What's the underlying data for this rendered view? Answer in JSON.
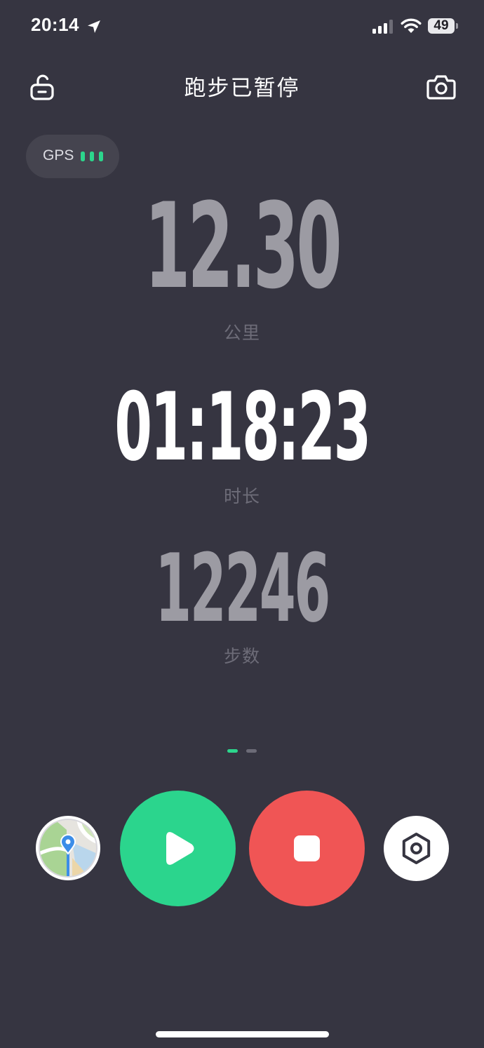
{
  "status_bar": {
    "time": "20:14",
    "battery": "49",
    "location_icon": "location-arrow-icon",
    "signal_icon": "cellular-signal-icon",
    "wifi_icon": "wifi-icon"
  },
  "header": {
    "title": "跑步已暂停",
    "lock_icon": "unlock-icon",
    "camera_icon": "camera-icon"
  },
  "gps": {
    "label": "GPS",
    "signal_bars": 3,
    "signal_color": "#2cd58c"
  },
  "metrics": {
    "distance": {
      "value": "12.30",
      "label": "公里"
    },
    "duration": {
      "value": "01:18:23",
      "label": "时长"
    },
    "steps": {
      "value": "12246",
      "label": "步数"
    }
  },
  "pager": {
    "total": 2,
    "active": 0
  },
  "controls": {
    "map_icon": "map-pin-icon",
    "resume_icon": "play-icon",
    "resume_color": "#2bd58d",
    "stop_icon": "stop-icon",
    "stop_color": "#f05555",
    "settings_icon": "hexagon-settings-icon"
  },
  "colors": {
    "background": "#363541",
    "accent": "#2cd58c"
  }
}
